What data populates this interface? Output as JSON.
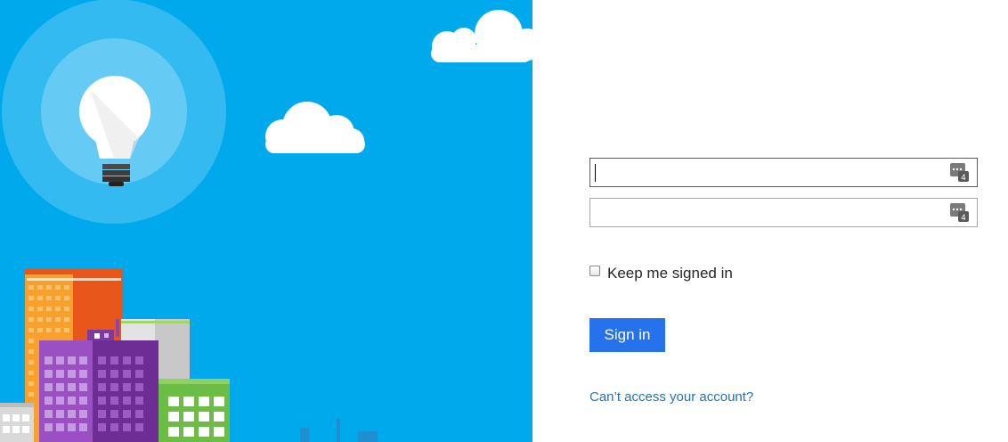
{
  "illustration": {
    "sky_color": "#00a9ec",
    "icons": [
      "lightbulb-icon",
      "cloud-icon",
      "city-skyline"
    ]
  },
  "form": {
    "username": {
      "value": "",
      "placeholder": "",
      "icon": "password-manager-icon"
    },
    "password": {
      "value": "",
      "placeholder": "",
      "icon": "password-manager-icon"
    },
    "remember_label": "Keep me signed in",
    "remember_checked": false,
    "signin_label": "Sign in",
    "help_link": "Can’t access your account?"
  },
  "colors": {
    "primary_button": "#2672ec",
    "link": "#2672b8",
    "field_border": "#a6a6a6"
  }
}
